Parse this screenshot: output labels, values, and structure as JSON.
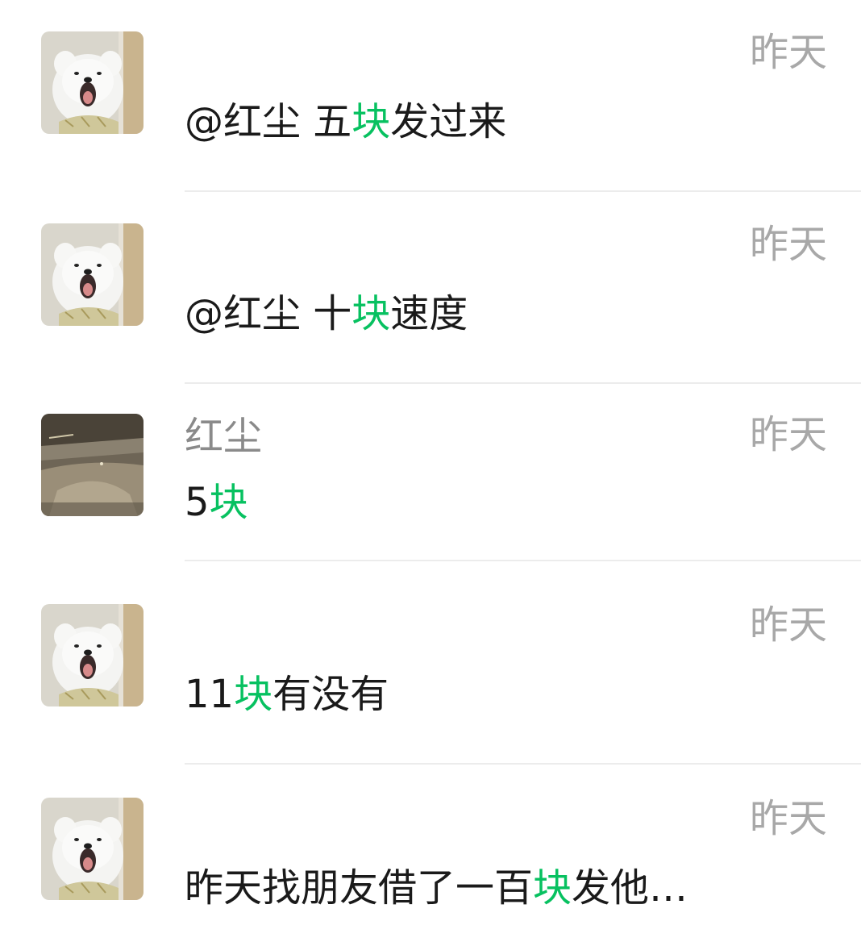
{
  "highlight_color": "#07c160",
  "avatars": {
    "dog": "white-puppy-avatar",
    "scene": "night-street-avatar"
  },
  "results": [
    {
      "avatar": "white-puppy-avatar",
      "sender": "",
      "time": "昨天",
      "message": {
        "before": "@红尘 五",
        "keyword": "块",
        "after": "发过来"
      }
    },
    {
      "avatar": "white-puppy-avatar",
      "sender": "",
      "time": "昨天",
      "message": {
        "before": "@红尘 十",
        "keyword": "块",
        "after": "速度"
      }
    },
    {
      "avatar": "night-street-avatar",
      "sender": "红尘",
      "time": "昨天",
      "message": {
        "before": "5",
        "keyword": "块",
        "after": ""
      }
    },
    {
      "avatar": "white-puppy-avatar",
      "sender": "",
      "time": "昨天",
      "message": {
        "before": "11",
        "keyword": "块",
        "after": "有没有"
      }
    },
    {
      "avatar": "white-puppy-avatar",
      "sender": "",
      "time": "昨天",
      "message": {
        "before": "昨天找朋友借了一百",
        "keyword": "块",
        "after": "发他…"
      }
    }
  ]
}
